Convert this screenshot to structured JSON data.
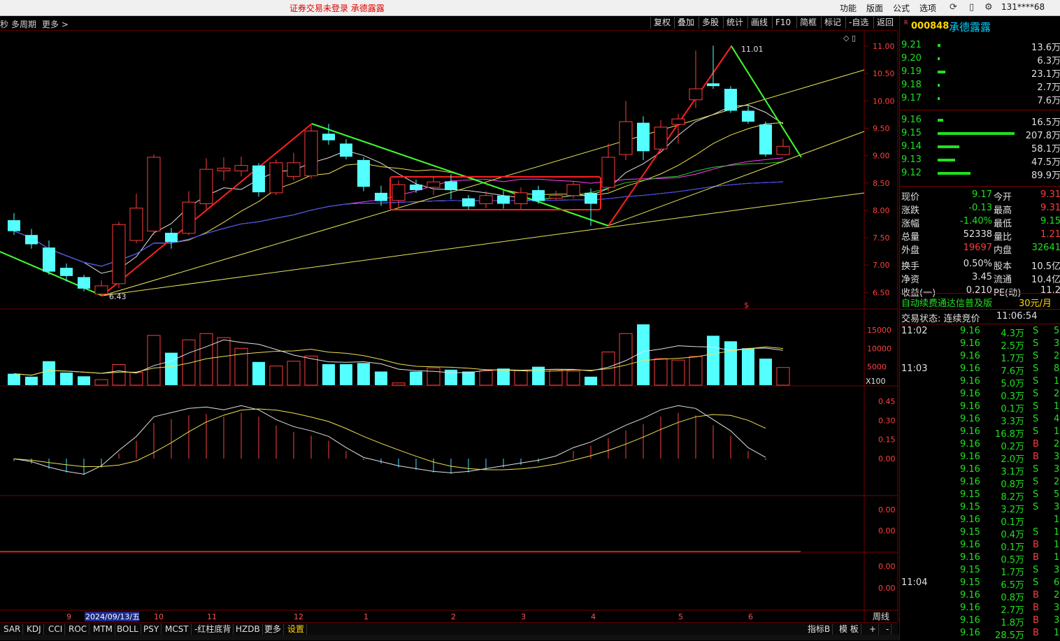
{
  "topbar": {
    "notice": "证券交易未登录  承德露露",
    "menus": [
      "功能",
      "版面",
      "公式",
      "选项"
    ],
    "account": "131****68"
  },
  "toolbar": {
    "left": [
      "秒",
      "多周期",
      "更多 >"
    ],
    "buttons": [
      "复权",
      "叠加",
      "多股",
      "统计",
      "画线",
      "F10",
      "简框",
      "标记",
      "-自选",
      "返回"
    ]
  },
  "stock": {
    "badge": "R",
    "code": "000848",
    "name": "承德露露"
  },
  "order_book": {
    "asks": [
      {
        "price": "9.21",
        "vol": "13.6万",
        "bar": 0.04
      },
      {
        "price": "9.20",
        "vol": "6.3万",
        "bar": 0.02
      },
      {
        "price": "9.19",
        "vol": "23.1万",
        "bar": 0.1
      },
      {
        "price": "9.18",
        "vol": "2.7万",
        "bar": 0.01
      },
      {
        "price": "9.17",
        "vol": "7.6万",
        "bar": 0.03
      }
    ],
    "bids": [
      {
        "price": "9.16",
        "vol": "16.5万",
        "bar": 0.07
      },
      {
        "price": "9.15",
        "vol": "207.8万",
        "bar": 1.0
      },
      {
        "price": "9.14",
        "vol": "58.1万",
        "bar": 0.28
      },
      {
        "price": "9.13",
        "vol": "47.5万",
        "bar": 0.23
      },
      {
        "price": "9.12",
        "vol": "89.9万",
        "bar": 0.43
      }
    ]
  },
  "quote": [
    {
      "l1": "现价",
      "v1": "9.17",
      "c1": "g",
      "l2": "今开",
      "v2": "9.31",
      "c2": "r"
    },
    {
      "l1": "涨跌",
      "v1": "-0.13",
      "c1": "g",
      "l2": "最高",
      "v2": "9.31",
      "c2": "r"
    },
    {
      "l1": "涨幅",
      "v1": "-1.40%",
      "c1": "g",
      "l2": "最低",
      "v2": "9.15",
      "c2": "g"
    },
    {
      "l1": "总量",
      "v1": "52338",
      "c1": "w",
      "l2": "量比",
      "v2": "1.21",
      "c2": "r"
    },
    {
      "l1": "外盘",
      "v1": "19697",
      "c1": "r",
      "l2": "内盘",
      "v2": "32641",
      "c2": "g"
    },
    {
      "l1": "换手",
      "v1": "0.50%",
      "c1": "w",
      "l2": "股本",
      "v2": "10.5亿",
      "c2": "w"
    },
    {
      "l1": "净资",
      "v1": "3.45",
      "c1": "w",
      "l2": "流通",
      "v2": "10.4亿",
      "c2": "w"
    },
    {
      "l1": "收益(一)",
      "v1": "0.210",
      "c1": "w",
      "l2": "PE(动)",
      "v2": "11.2",
      "c2": "w"
    }
  ],
  "promo": {
    "text": "自动续费通达信普及版",
    "price": "30元/月"
  },
  "trade_status": {
    "label": "交易状态: 连续竞价",
    "time": "11:06:54"
  },
  "ticks": [
    {
      "t": "11:02",
      "p": "9.16",
      "v": "4.3万",
      "s": "S",
      "n": "5"
    },
    {
      "t": "",
      "p": "9.16",
      "v": "2.5万",
      "s": "S",
      "n": "3"
    },
    {
      "t": "",
      "p": "9.16",
      "v": "1.7万",
      "s": "S",
      "n": "2"
    },
    {
      "t": "11:03",
      "p": "9.16",
      "v": "7.6万",
      "s": "S",
      "n": "8"
    },
    {
      "t": "",
      "p": "9.16",
      "v": "5.0万",
      "s": "S",
      "n": "15"
    },
    {
      "t": "",
      "p": "9.16",
      "v": "0.3万",
      "s": "S",
      "n": "2"
    },
    {
      "t": "",
      "p": "9.16",
      "v": "0.1万",
      "s": "S",
      "n": "1"
    },
    {
      "t": "",
      "p": "9.16",
      "v": "3.3万",
      "s": "S",
      "n": "4"
    },
    {
      "t": "",
      "p": "9.16",
      "v": "16.8万",
      "s": "S",
      "n": "18"
    },
    {
      "t": "",
      "p": "9.16",
      "v": "0.2万",
      "s": "B",
      "n": "2"
    },
    {
      "t": "",
      "p": "9.16",
      "v": "2.0万",
      "s": "B",
      "n": "3"
    },
    {
      "t": "",
      "p": "9.16",
      "v": "3.1万",
      "s": "S",
      "n": "3"
    },
    {
      "t": "",
      "p": "9.16",
      "v": "0.8万",
      "s": "S",
      "n": "2"
    },
    {
      "t": "",
      "p": "9.15",
      "v": "8.2万",
      "s": "S",
      "n": "5"
    },
    {
      "t": "",
      "p": "9.15",
      "v": "3.2万",
      "s": "S",
      "n": "3"
    },
    {
      "t": "",
      "p": "9.16",
      "v": "0.1万",
      "s": "",
      "n": "1"
    },
    {
      "t": "",
      "p": "9.15",
      "v": "0.4万",
      "s": "S",
      "n": "1"
    },
    {
      "t": "",
      "p": "9.16",
      "v": "0.1万",
      "s": "B",
      "n": "1"
    },
    {
      "t": "",
      "p": "9.16",
      "v": "0.5万",
      "s": "B",
      "n": "1"
    },
    {
      "t": "",
      "p": "9.15",
      "v": "1.7万",
      "s": "S",
      "n": "3"
    },
    {
      "t": "11:04",
      "p": "9.15",
      "v": "6.5万",
      "s": "S",
      "n": "6"
    },
    {
      "t": "",
      "p": "9.16",
      "v": "0.8万",
      "s": "B",
      "n": "2"
    },
    {
      "t": "",
      "p": "9.16",
      "v": "2.7万",
      "s": "B",
      "n": "3"
    },
    {
      "t": "",
      "p": "9.16",
      "v": "1.8万",
      "s": "B",
      "n": "3"
    },
    {
      "t": "",
      "p": "9.16",
      "v": "28.5万",
      "s": "B",
      "n": "12"
    }
  ],
  "axes": {
    "price_ticks": [
      "11.00",
      "10.50",
      "10.00",
      "9.50",
      "9.00",
      "8.50",
      "8.00",
      "7.50",
      "7.00",
      "6.50"
    ],
    "volume_ticks": [
      "15000",
      "10000",
      "5000"
    ],
    "volume_unit": "X100",
    "macd_ticks": [
      "0.45",
      "0.30",
      "0.15",
      "0.00"
    ],
    "panel4_ticks": [
      "0.00",
      "0.00"
    ],
    "panel5_ticks": [
      "0.00",
      "0.00"
    ],
    "date_labels": [
      "9",
      "2024/09/13/五",
      "10",
      "11",
      "12",
      "1",
      "2",
      "3",
      "4",
      "5",
      "6"
    ],
    "period": "周线",
    "high_label": "11.01",
    "low_label": "6.43",
    "marker": "$"
  },
  "chart_data": {
    "type": "candlestick",
    "period": "weekly",
    "candles": [
      [
        7.82,
        7.62,
        7.95,
        7.55
      ],
      [
        7.55,
        7.38,
        7.66,
        7.3
      ],
      [
        7.32,
        6.88,
        7.45,
        6.82
      ],
      [
        6.95,
        6.8,
        7.03,
        6.7
      ],
      [
        6.78,
        6.57,
        6.82,
        6.52
      ],
      [
        6.47,
        6.62,
        6.72,
        6.43
      ],
      [
        6.66,
        7.74,
        7.79,
        6.58
      ],
      [
        7.45,
        8.04,
        8.3,
        7.4
      ],
      [
        7.62,
        8.97,
        9.02,
        7.55
      ],
      [
        7.59,
        7.42,
        7.68,
        7.3
      ],
      [
        7.58,
        8.15,
        8.35,
        7.55
      ],
      [
        8.12,
        8.75,
        8.95,
        8.02
      ],
      [
        8.72,
        8.77,
        8.97,
        8.54
      ],
      [
        8.72,
        8.82,
        8.98,
        8.62
      ],
      [
        8.82,
        8.33,
        8.86,
        8.25
      ],
      [
        8.32,
        8.87,
        8.93,
        8.28
      ],
      [
        8.62,
        8.87,
        9.05,
        8.55
      ],
      [
        8.63,
        9.45,
        9.55,
        8.58
      ],
      [
        9.4,
        9.28,
        9.58,
        9.2
      ],
      [
        9.22,
        8.98,
        9.3,
        8.93
      ],
      [
        8.92,
        8.43,
        8.97,
        8.35
      ],
      [
        8.32,
        8.17,
        8.45,
        8.08
      ],
      [
        8.18,
        8.47,
        8.55,
        8.06
      ],
      [
        8.47,
        8.37,
        8.56,
        8.32
      ],
      [
        8.42,
        8.52,
        8.62,
        8.28
      ],
      [
        8.53,
        8.37,
        8.66,
        8.2
      ],
      [
        8.22,
        8.07,
        8.28,
        8.02
      ],
      [
        8.12,
        8.27,
        8.35,
        8.04
      ],
      [
        8.27,
        8.12,
        8.36,
        8.03
      ],
      [
        8.12,
        8.32,
        8.42,
        8.02
      ],
      [
        8.37,
        8.17,
        8.45,
        8.12
      ],
      [
        8.22,
        8.27,
        8.36,
        8.18
      ],
      [
        8.27,
        8.47,
        8.52,
        8.22
      ],
      [
        8.32,
        8.12,
        8.4,
        7.72
      ],
      [
        8.42,
        8.97,
        9.22,
        8.35
      ],
      [
        9.02,
        9.62,
        10.0,
        8.92
      ],
      [
        9.6,
        9.08,
        9.72,
        8.92
      ],
      [
        9.12,
        9.52,
        9.65,
        9.08
      ],
      [
        9.57,
        9.67,
        9.76,
        9.22
      ],
      [
        10.02,
        10.22,
        10.92,
        9.87
      ],
      [
        10.32,
        10.27,
        11.01,
        10.22
      ],
      [
        10.22,
        9.82,
        10.27,
        9.78
      ],
      [
        9.82,
        9.62,
        9.91,
        9.58
      ],
      [
        9.57,
        9.02,
        9.62,
        8.98
      ],
      [
        9.02,
        9.17,
        9.31,
        9.15
      ]
    ],
    "volume_x100": [
      3100,
      2300,
      6500,
      3400,
      2400,
      1500,
      5600,
      3500,
      13500,
      8800,
      12300,
      14000,
      12900,
      10000,
      6300,
      5200,
      6500,
      7900,
      5700,
      5700,
      6000,
      3700,
      600,
      3700,
      4700,
      4200,
      3700,
      3900,
      4500,
      4000,
      5000,
      4200,
      3800,
      2300,
      9000,
      14000,
      16500,
      7200,
      6800,
      7800,
      13400,
      11900,
      10000,
      7200,
      4800,
      3800
    ],
    "macd_hist": [
      -0.02,
      -0.04,
      -0.08,
      -0.11,
      -0.13,
      -0.07,
      0.04,
      0.14,
      0.28,
      0.31,
      0.34,
      0.35,
      0.33,
      0.36,
      0.33,
      0.26,
      0.21,
      0.18,
      0.14,
      0.06,
      -0.01,
      -0.04,
      -0.07,
      -0.09,
      -0.11,
      -0.12,
      -0.11,
      -0.09,
      -0.07,
      -0.05,
      -0.03,
      0.0,
      0.06,
      0.1,
      0.16,
      0.22,
      0.27,
      0.33,
      0.36,
      0.34,
      0.26,
      0.18,
      0.06,
      -0.01
    ]
  }
}
